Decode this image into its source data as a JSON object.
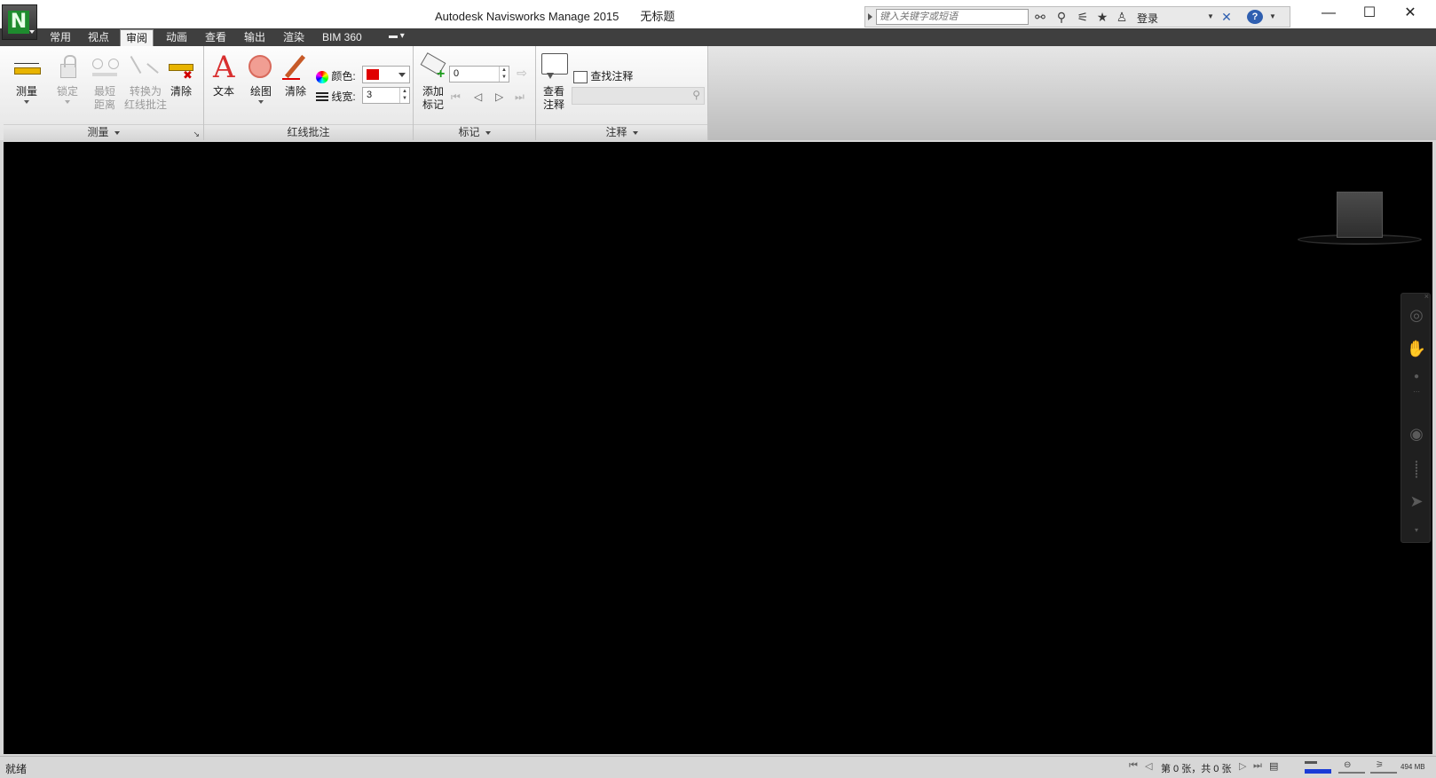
{
  "window": {
    "app_name": "Autodesk Navisworks Manage 2015",
    "doc_name": "无标题",
    "minimize": "—",
    "maximize": "☐",
    "close": "✕"
  },
  "app_button": {
    "letter": "N"
  },
  "infocenter": {
    "search_placeholder": "键入关键字或短语",
    "login": "登录"
  },
  "tabs": [
    {
      "label": "常用"
    },
    {
      "label": "视点"
    },
    {
      "label": "审阅"
    },
    {
      "label": "动画"
    },
    {
      "label": "查看"
    },
    {
      "label": "输出"
    },
    {
      "label": "渲染"
    },
    {
      "label": "BIM 360"
    }
  ],
  "active_tab": "审阅",
  "panels": {
    "measure": {
      "title": "测量",
      "measure": "测量",
      "lock": "锁定",
      "shortest_l1": "最短",
      "shortest_l2": "距离",
      "convert_l1": "转换为",
      "convert_l2": "红线批注",
      "clear": "清除"
    },
    "redline": {
      "title": "红线批注",
      "text": "文本",
      "draw": "绘图",
      "clear": "清除",
      "color_label": "颜色:",
      "width_label": "线宽:",
      "width_value": "3",
      "color": "#e00000"
    },
    "tags": {
      "title": "标记",
      "add_l1": "添加",
      "add_l2": "标记",
      "tag_value": "0"
    },
    "comments": {
      "title": "注释",
      "view_l1": "查看",
      "view_l2": "注释",
      "find": "查找注释"
    }
  },
  "statusbar": {
    "status": "就绪",
    "sheet_info": "第 0 张，共 0 张",
    "memory": "494 MB"
  }
}
